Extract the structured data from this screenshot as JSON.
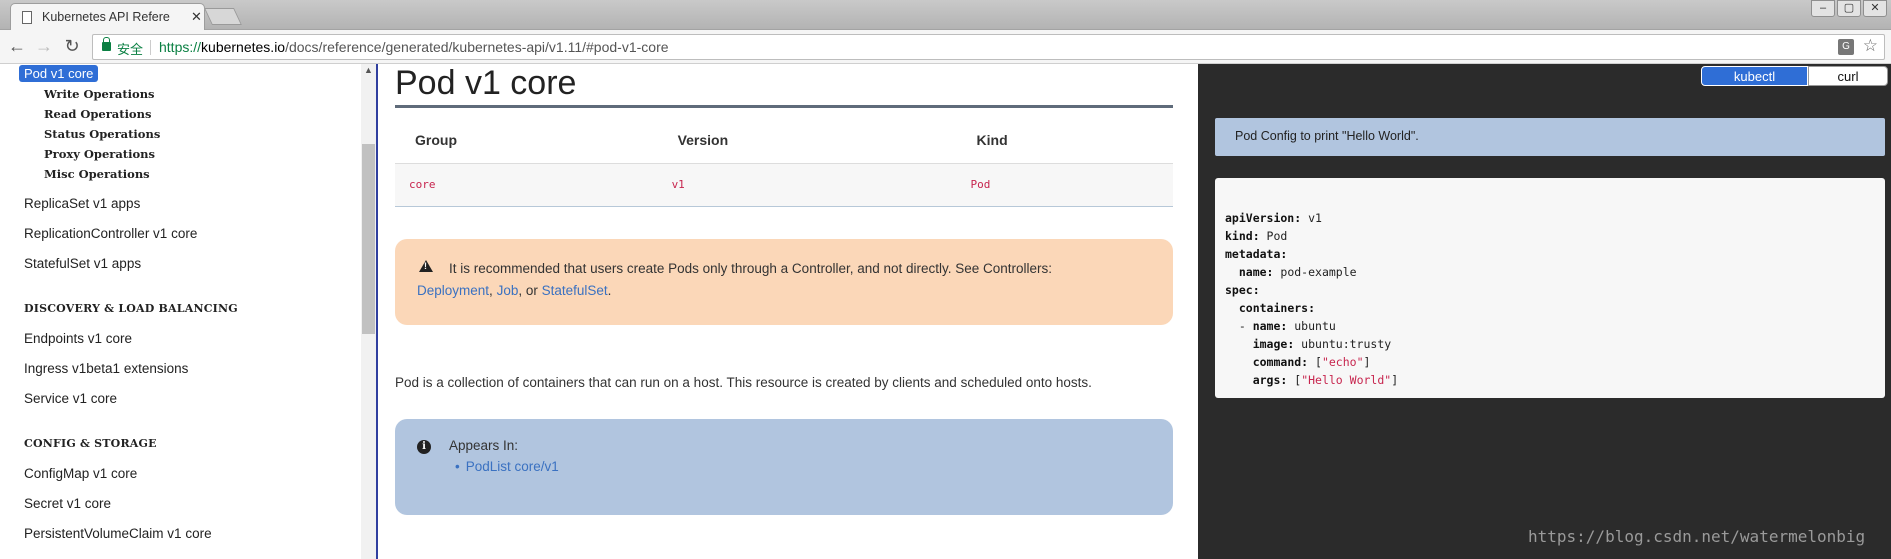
{
  "browser": {
    "tab_title": "Kubernetes API Refere",
    "tab_close": "✕",
    "secure_label": "安全",
    "url_protocol": "https://",
    "url_host": "kubernetes.io",
    "url_path": "/docs/reference/generated/kubernetes-api/v1.11/#pod-v1-core",
    "translate_glyph": "G",
    "star_glyph": "☆",
    "back_glyph": "←",
    "forward_glyph": "→",
    "reload_glyph": "↻",
    "window_buttons": [
      "–",
      "▢",
      "✕"
    ]
  },
  "sidebar": {
    "active_item": "Pod v1 core",
    "sub_items": [
      "Write Operations",
      "Read Operations",
      "Status Operations",
      "Proxy Operations",
      "Misc Operations"
    ],
    "items_workloads": [
      "ReplicaSet v1 apps",
      "ReplicationController v1 core",
      "StatefulSet v1 apps"
    ],
    "heading_discovery": "DISCOVERY & LOAD BALANCING",
    "items_discovery": [
      "Endpoints v1 core",
      "Ingress v1beta1 extensions",
      "Service v1 core"
    ],
    "heading_config": "CONFIG & STORAGE",
    "items_config": [
      "ConfigMap v1 core",
      "Secret v1 core",
      "PersistentVolumeClaim v1 core"
    ]
  },
  "main": {
    "title": "Pod v1 core",
    "table": {
      "headers": [
        "Group",
        "Version",
        "Kind"
      ],
      "row": [
        "core",
        "v1",
        "Pod"
      ]
    },
    "warning": {
      "text": "It is recommended that users create Pods only through a Controller, and not directly. See Controllers:",
      "links": [
        "Deployment",
        "Job",
        "StatefulSet"
      ],
      "sep1": ", ",
      "sep2": ", or ",
      "end": "."
    },
    "description": "Pod is a collection of containers that can run on a host. This resource is created by clients and scheduled onto hosts.",
    "appears_in": {
      "label": "Appears In:",
      "link": "PodList core/v1"
    }
  },
  "code": {
    "tabs": [
      "kubectl",
      "curl"
    ],
    "caption": "Pod Config to print \"Hello World\".",
    "lines": [
      {
        "key": "apiVersion:",
        "value": " v1",
        "indent": ""
      },
      {
        "key": "kind:",
        "value": " Pod",
        "indent": ""
      },
      {
        "key": "metadata:",
        "value": "",
        "indent": ""
      },
      {
        "key": "name:",
        "value": " pod-example",
        "indent": "  "
      },
      {
        "key": "spec:",
        "value": "",
        "indent": ""
      },
      {
        "key": "containers:",
        "value": "",
        "indent": "  "
      },
      {
        "key": "name:",
        "value": " ubuntu",
        "indent": "  - "
      },
      {
        "key": "image:",
        "value": " ubuntu:trusty",
        "indent": "    "
      },
      {
        "key": "command:",
        "value": " [\"echo\"]",
        "indent": "    "
      },
      {
        "key": "args:",
        "value": " [\"Hello World\"]",
        "indent": "    "
      }
    ]
  },
  "watermark": "https://blog.csdn.net/watermelonbig"
}
